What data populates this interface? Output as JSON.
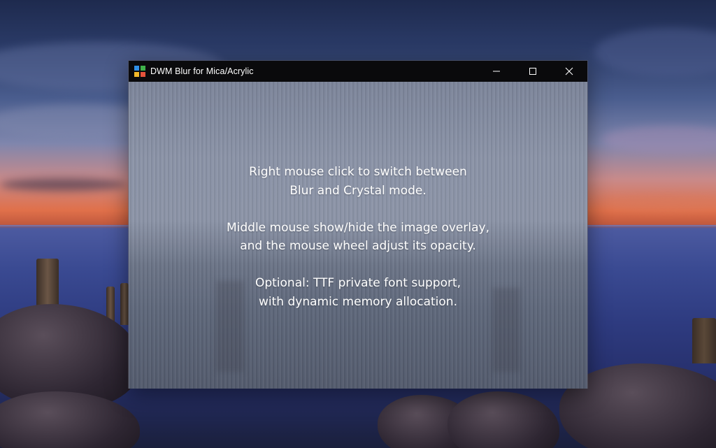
{
  "window": {
    "title": "DWM Blur for Mica/Acrylic",
    "controls": {
      "minimize": "minimize",
      "maximize": "maximize",
      "close": "close"
    }
  },
  "message": {
    "paragraphs": [
      [
        "Right mouse click to switch between",
        "Blur and Crystal mode."
      ],
      [
        "Middle mouse show/hide the image overlay,",
        "and the mouse wheel adjust its opacity."
      ],
      [
        "Optional: TTF private font support,",
        "with dynamic memory allocation."
      ]
    ]
  },
  "icons": {
    "app": "windows-tiles-icon",
    "minimize": "minimize-icon",
    "maximize": "maximize-icon",
    "close": "close-icon"
  },
  "colors": {
    "titlebar_bg": "#0a0a0c",
    "titlebar_text": "#ffffff",
    "message_text": "#ffffff",
    "icon_tile_1": "#2f8fe6",
    "icon_tile_2": "#3fb24a",
    "icon_tile_3": "#f2b829",
    "icon_tile_4": "#e5533b"
  }
}
